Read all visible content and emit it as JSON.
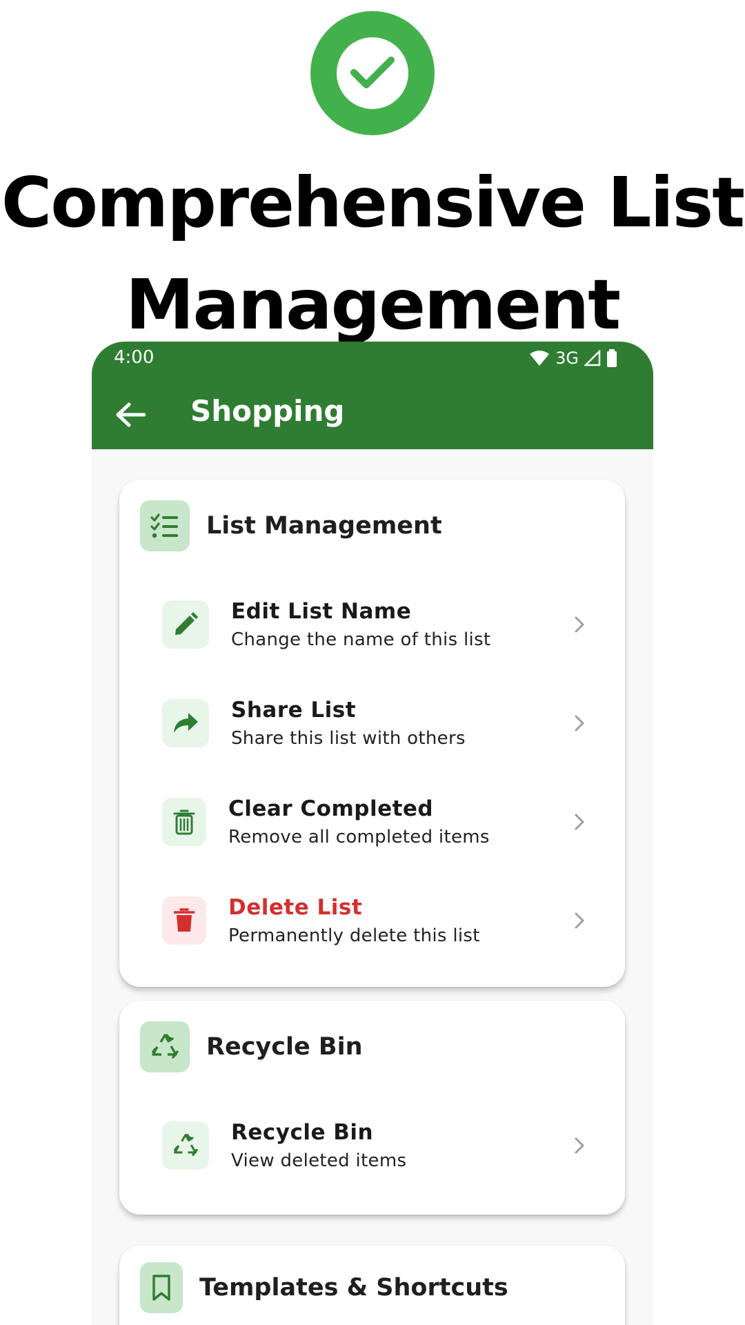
{
  "hero": {
    "badge_icon": "check-circle-icon",
    "title": "Comprehensive List Management"
  },
  "status_bar": {
    "time": "4:00",
    "network": "3G",
    "icons": [
      "wifi-icon",
      "cell-signal-icon",
      "battery-icon"
    ]
  },
  "app_bar": {
    "title": "Shopping",
    "back_icon": "back-arrow-icon"
  },
  "sections": {
    "list_management": {
      "title": "List Management",
      "icon": "checklist-icon",
      "items": [
        {
          "title": "Edit List Name",
          "subtitle": "Change the name of this list",
          "icon": "pencil-icon"
        },
        {
          "title": "Share List",
          "subtitle": "Share this list with others",
          "icon": "share-icon"
        },
        {
          "title": "Clear Completed",
          "subtitle": "Remove all completed items",
          "icon": "trash-outline-icon"
        },
        {
          "title": "Delete List",
          "subtitle": "Permanently delete this list",
          "icon": "trash-icon"
        }
      ]
    },
    "recycle_bin": {
      "title": "Recycle Bin",
      "icon": "recycle-icon",
      "items": [
        {
          "title": "Recycle Bin",
          "subtitle": "View deleted items",
          "icon": "recycle-icon"
        }
      ]
    },
    "templates": {
      "title": "Templates & Shortcuts",
      "icon": "bookmark-icon"
    }
  },
  "colors": {
    "primary": "#2e7d32",
    "badge": "#43b14b",
    "danger": "#d32f2f",
    "icon_bg": "#e8f5e9",
    "danger_bg": "#fde8ea"
  }
}
